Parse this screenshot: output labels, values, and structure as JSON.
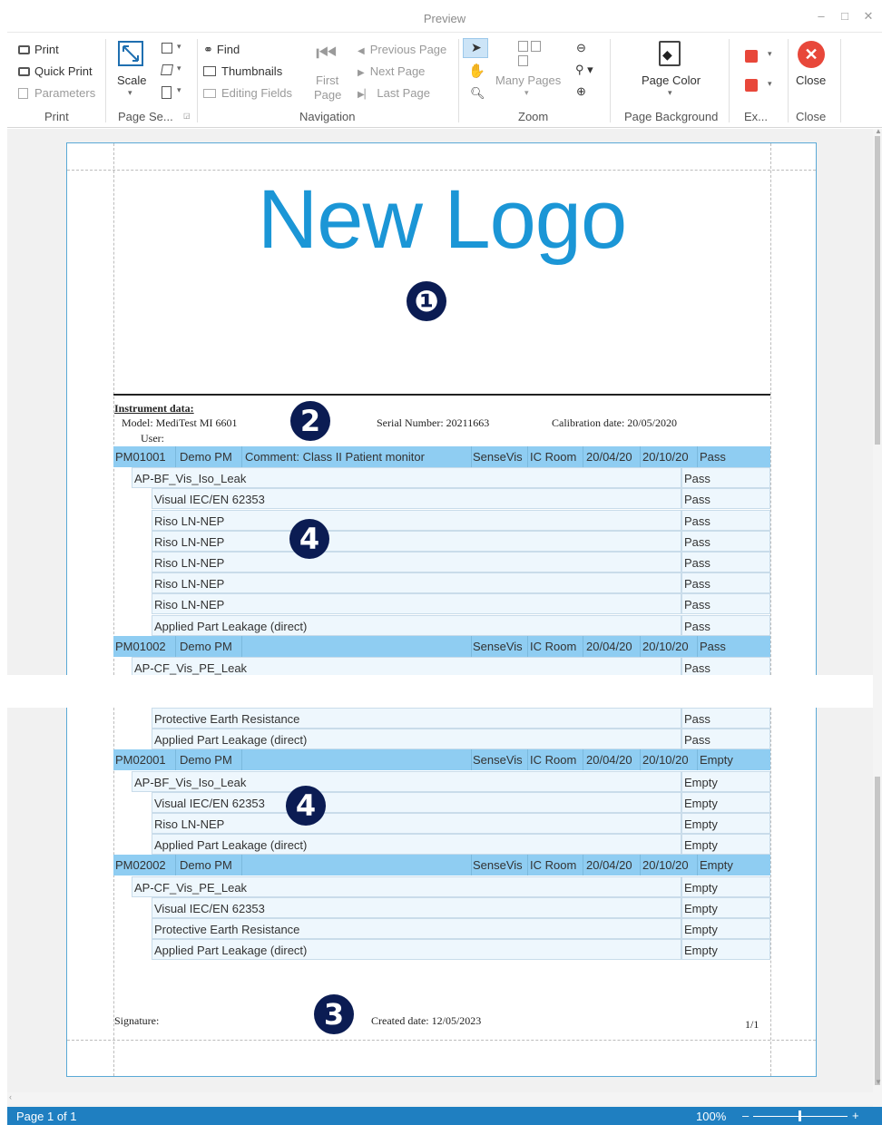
{
  "window": {
    "title": "Preview",
    "minimize": "–",
    "maximize": "□",
    "close": "✕"
  },
  "ribbon": {
    "print_group": {
      "print": "Print",
      "quick_print": "Quick Print",
      "parameters": "Parameters",
      "label": "Print"
    },
    "page_setup_group": {
      "scale": "Scale",
      "label": "Page Se..."
    },
    "navigation_group": {
      "find": "Find",
      "thumbnails": "Thumbnails",
      "editing_fields": "Editing Fields",
      "first_page_1": "First",
      "first_page_2": "Page",
      "previous_page": "Previous Page",
      "next_page": "Next  Page",
      "last_page": "Last  Page",
      "label": "Navigation"
    },
    "zoom_group": {
      "many_pages": "Many Pages",
      "label": "Zoom"
    },
    "background_group": {
      "page_color": "Page Color",
      "label": "Page Background"
    },
    "export_group": {
      "label": "Ex..."
    },
    "close_group": {
      "close": "Close",
      "label": "Close"
    }
  },
  "report": {
    "logo_text": "New Logo",
    "markers": {
      "one": "❶",
      "two": "2",
      "three": "3",
      "four": "4"
    },
    "instrument": {
      "heading": "Instrument data:",
      "model": "Model: MediTest MI 6601",
      "user": "User:",
      "serial": "Serial Number: 20211663",
      "calibration": "Calibration date: 20/05/2020"
    },
    "rows_top": [
      {
        "kind": "pm",
        "id": "PM01001",
        "name": "Demo PM",
        "comment": "Comment: Class II Patient monitor",
        "location": "SenseVis",
        "room": "IC Room",
        "date1": "20/04/20",
        "date2": "20/10/20",
        "result": "Pass"
      },
      {
        "kind": "test",
        "level": 1,
        "label": "AP-BF_Vis_Iso_Leak",
        "result": "Pass"
      },
      {
        "kind": "test",
        "level": 2,
        "label": "Visual IEC/EN 62353",
        "result": "Pass"
      },
      {
        "kind": "test",
        "level": 2,
        "label": "Riso LN-NEP",
        "result": "Pass"
      },
      {
        "kind": "test",
        "level": 2,
        "label": "Riso LN-NEP",
        "result": "Pass"
      },
      {
        "kind": "test",
        "level": 2,
        "label": "Riso LN-NEP",
        "result": "Pass"
      },
      {
        "kind": "test",
        "level": 2,
        "label": "Riso LN-NEP",
        "result": "Pass"
      },
      {
        "kind": "test",
        "level": 2,
        "label": "Riso LN-NEP",
        "result": "Pass"
      },
      {
        "kind": "test",
        "level": 2,
        "label": "Applied Part Leakage (direct)",
        "result": "Pass"
      },
      {
        "kind": "pm",
        "id": "PM01002",
        "name": "Demo PM",
        "comment": "",
        "location": "SenseVis",
        "room": "IC Room",
        "date1": "20/04/20",
        "date2": "20/10/20",
        "result": "Pass"
      },
      {
        "kind": "test",
        "level": 1,
        "label": "AP-CF_Vis_PE_Leak",
        "result": "Pass"
      }
    ],
    "rows_bottom": [
      {
        "kind": "test",
        "level": 2,
        "label": "Protective Earth Resistance",
        "result": "Pass"
      },
      {
        "kind": "test",
        "level": 2,
        "label": "Applied Part Leakage (direct)",
        "result": "Pass"
      },
      {
        "kind": "pm",
        "id": "PM02001",
        "name": "Demo PM",
        "comment": "",
        "location": "SenseVis",
        "room": "IC Room",
        "date1": "20/04/20",
        "date2": "20/10/20",
        "result": "Empty"
      },
      {
        "kind": "test",
        "level": 1,
        "label": "AP-BF_Vis_Iso_Leak",
        "result": "Empty"
      },
      {
        "kind": "test",
        "level": 2,
        "label": "Visual IEC/EN 62353",
        "result": "Empty"
      },
      {
        "kind": "test",
        "level": 2,
        "label": "Riso LN-NEP",
        "result": "Empty"
      },
      {
        "kind": "test",
        "level": 2,
        "label": "Applied Part Leakage (direct)",
        "result": "Empty"
      },
      {
        "kind": "pm",
        "id": "PM02002",
        "name": "Demo PM",
        "comment": "",
        "location": "SenseVis",
        "room": "IC Room",
        "date1": "20/04/20",
        "date2": "20/10/20",
        "result": "Empty"
      },
      {
        "kind": "test",
        "level": 1,
        "label": "AP-CF_Vis_PE_Leak",
        "result": "Empty"
      },
      {
        "kind": "test",
        "level": 2,
        "label": "Visual IEC/EN 62353",
        "result": "Empty"
      },
      {
        "kind": "test",
        "level": 2,
        "label": "Protective Earth Resistance",
        "result": "Empty"
      },
      {
        "kind": "test",
        "level": 2,
        "label": "Applied Part Leakage (direct)",
        "result": "Empty"
      }
    ],
    "footer": {
      "signature": "Signature:",
      "created": "Created date: 12/05/2023",
      "page": "1/1"
    }
  },
  "status": {
    "page": "Page 1 of 1",
    "zoom": "100%",
    "zoom_out": "–",
    "zoom_in": "+"
  },
  "colors": {
    "accent": "#1f7fc1",
    "pm_row": "#8fcdf2",
    "test_row": "#eef7fd",
    "marker": "#0b1c53",
    "logo": "#1b96d6",
    "close_icon": "#e8473a"
  }
}
